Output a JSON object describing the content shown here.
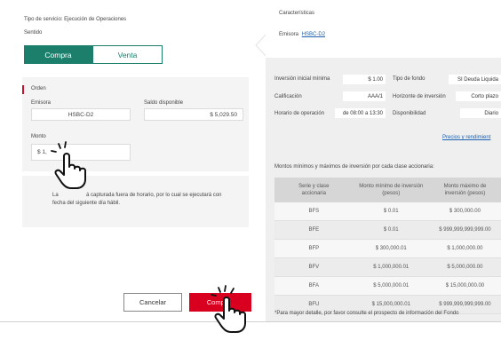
{
  "order_form": {
    "service_type": "Tipo de servicio: Ejecución de Operaciones",
    "direction_label": "Sentido",
    "tabs": [
      {
        "label": "Compra"
      },
      {
        "label": "Venta"
      }
    ],
    "section_title": "Orden",
    "issuer_label": "Emisora",
    "issuer_value": "HSBC-D2",
    "balance_label": "Saldo disponible",
    "balance_value": "$ 5,029.50",
    "amount_label": "Monto",
    "amount_value": "$ 1,",
    "notice_left": "La",
    "notice_text": "á capturada fuera de horario, por lo cual se ejecutará con",
    "notice_line2": "fecha del siguiente día hábil.",
    "cancel_label": "Cancelar",
    "buy_label": "Compr"
  },
  "fund_info": {
    "characteristics_label": "Características",
    "issuer_label": "Emisora",
    "issuer_link": "HSBC-D2",
    "min_investment_label": "Inversión inicial mínima",
    "min_investment_value": "$ 1.00",
    "fund_type_label": "Tipo de fondo",
    "fund_type_value": "SI Deuda Liquida",
    "rating_label": "Calificación",
    "rating_value": "AAA/1",
    "horizon_label": "Horizonte de inversión",
    "horizon_value": "Corto plazo",
    "hours_label": "Horario de operación",
    "hours_value": "de 08:00 a 13:30",
    "availability_label": "Disponibilidad",
    "availability_value": "Diario",
    "prices_link": "Precios y rendimient",
    "table_caption": "Montos mínimos y máximos de inversión por cada clase accionaria:",
    "table_headers": [
      "Serie y clase accionaria",
      "Monto mínimo de inversión (pesos)",
      "Monto máximo de inversión (pesos)"
    ],
    "table_rows": [
      [
        "BFS",
        "$ 0.01",
        "$ 300,000.00"
      ],
      [
        "BFE",
        "$ 0.01",
        "$ 999,999,999,999.00"
      ],
      [
        "BFP",
        "$ 300,000.01",
        "$ 1,000,000.00"
      ],
      [
        "BFV",
        "$ 1,000,000.01",
        "$ 5,000,000.00"
      ],
      [
        "BFA",
        "$ 5,000,000.01",
        "$ 15,000,000.00"
      ],
      [
        "BFU",
        "$ 15,000,000.01",
        "$ 999,999,999,999.00"
      ]
    ],
    "footnote": "*Para mayor detalle, por favor consulte el prospecto de información del Fondo"
  },
  "colors": {
    "accent_green": "#1c7f6c",
    "buy_red": "#d8001e",
    "order_marker": "#c8102e"
  }
}
